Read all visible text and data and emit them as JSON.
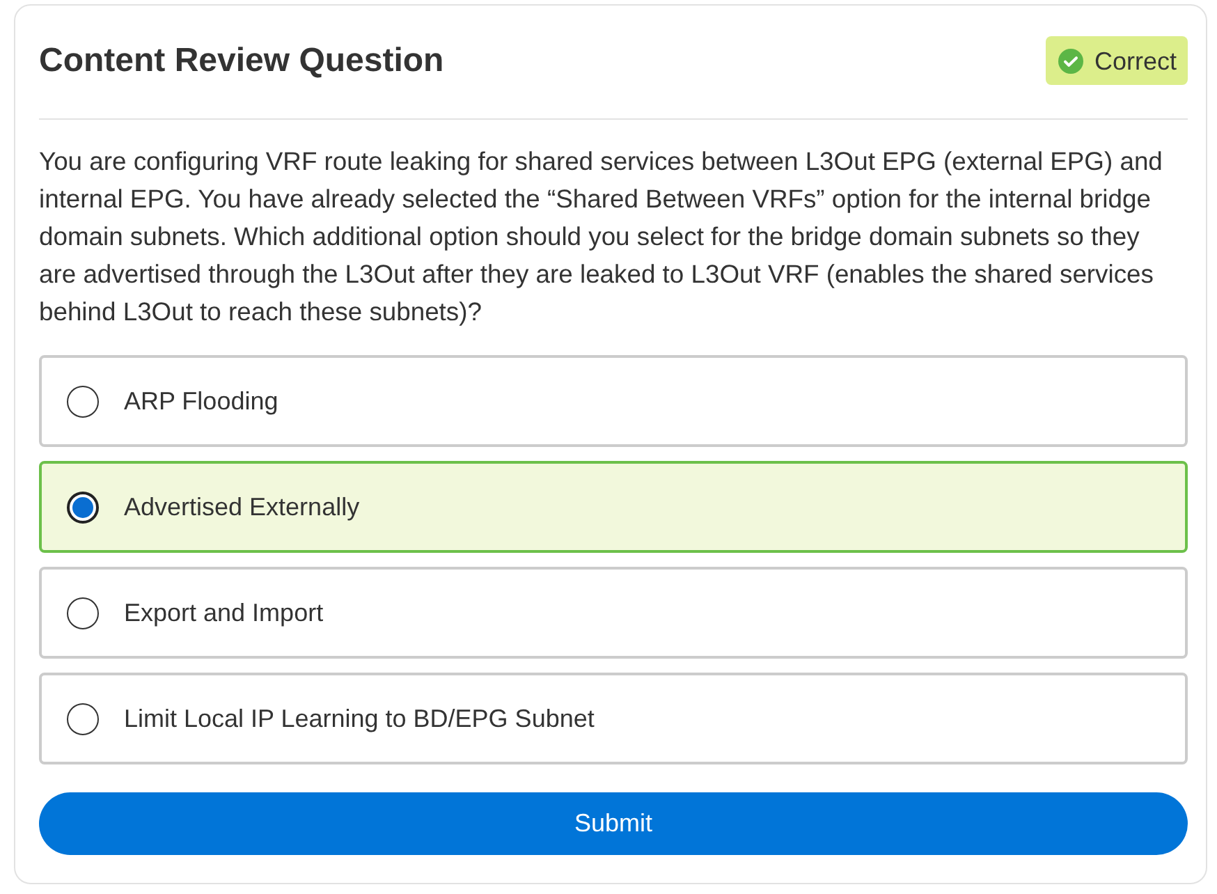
{
  "card": {
    "title": "Content Review Question",
    "badge": {
      "label": "Correct",
      "kind": "correct"
    }
  },
  "question": "You are configuring VRF route leaking for shared services between L3Out EPG (external EPG) and internal EPG. You have already selected the “Shared Between VRFs” option for the internal bridge domain subnets. Which additional option should you select for the bridge domain subnets so they are advertised through the L3Out after they are leaked to L3Out VRF (enables the shared services behind L3Out to reach these subnets)?",
  "options": [
    {
      "label": "ARP Flooding",
      "selected": false,
      "correct": false
    },
    {
      "label": "Advertised Externally",
      "selected": true,
      "correct": true
    },
    {
      "label": "Export and Import",
      "selected": false,
      "correct": false
    },
    {
      "label": "Limit Local IP Learning to BD/EPG Subnet",
      "selected": false,
      "correct": false
    }
  ],
  "submit_button": {
    "label": "Submit"
  }
}
